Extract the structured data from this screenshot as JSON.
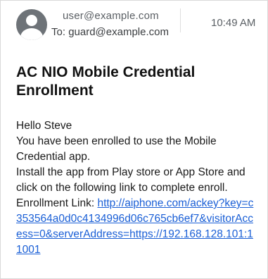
{
  "email": {
    "from": "user@example.com",
    "to_prefix": "To: ",
    "to": "guard@example.com",
    "time": "10:49 AM",
    "subject": "AC NIO Mobile Credential Enrollment",
    "greeting": "Hello Steve",
    "line1": "You have been enrolled to use the Mobile Credential app.",
    "line2": "Install the app from Play store or App Store and click on the following link to complete enroll.",
    "link_label": "Enrollment Link: ",
    "link_text": "http://aiphone.com/ackey?key=c353564a0d0c4134996d06c765cb6ef7&visitorAccess=0&serverAddress=https://192.168.128.101:11001"
  },
  "icons": {
    "avatar": "person-avatar-icon"
  },
  "colors": {
    "link": "#1a5fd6",
    "avatar_bg": "#6e7378",
    "meta_text": "#5a5f64"
  }
}
